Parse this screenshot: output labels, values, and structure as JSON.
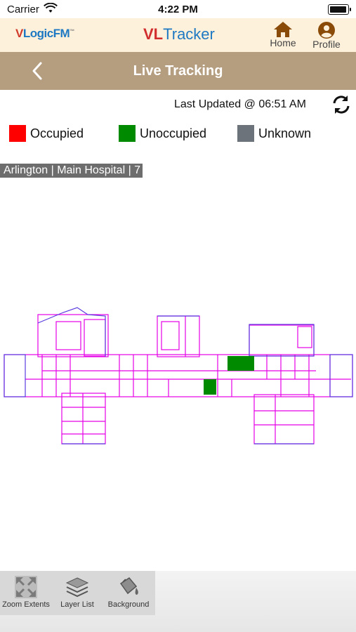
{
  "status_bar": {
    "carrier": "Carrier",
    "time": "4:22 PM"
  },
  "header": {
    "brand_v": "V",
    "brand_rest": "LogicFM",
    "brand_tm": "™",
    "title_vl": "VL",
    "title_rest": "Tracker",
    "home_label": "Home",
    "profile_label": "Profile"
  },
  "nav": {
    "title": "Live Tracking"
  },
  "last_updated": "Last Updated @ 06:51 AM",
  "legend": [
    {
      "label": "Occupied",
      "color": "#ff0000"
    },
    {
      "label": "Unoccupied",
      "color": "#008a00"
    },
    {
      "label": "Unknown",
      "color": "#6d737a"
    }
  ],
  "location": "Arlington | Main Hospital | 7",
  "floor_plan": {
    "wall_color": "#e600e6",
    "outline_color": "#5a3ce0",
    "occupied_color": "#008a00"
  },
  "toolbar": {
    "zoom_label": "Zoom Extents",
    "layers_label": "Layer List",
    "background_label": "Background"
  }
}
